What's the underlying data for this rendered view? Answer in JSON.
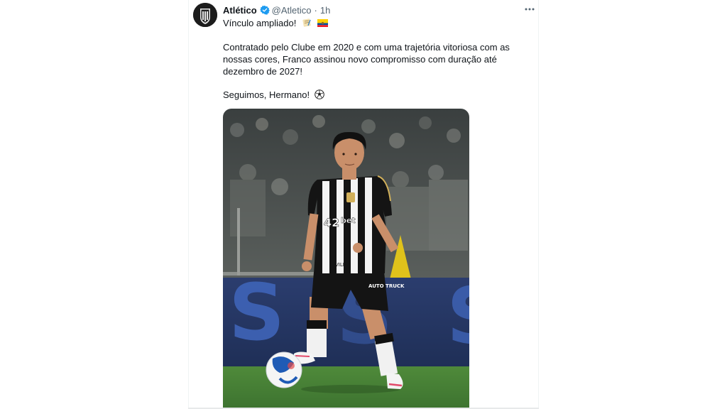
{
  "tweet": {
    "display_name": "Atlético",
    "handle": "@Atletico",
    "separator": "·",
    "time": "1h",
    "text_line1": "Vínculo ampliado!",
    "text_paragraph2": "Contratado pelo Clube em 2020 e com uma trajetória vitoriosa com as nossas cores, Franco assinou novo compromisso com duração até dezembro de 2027!",
    "text_line3": "Seguimos, Hermano!",
    "more_label": "···"
  },
  "media": {
    "image_text": {
      "sponsor": "bet",
      "sponsor_number": "42",
      "shorts_badge": "AUTO TRUCK",
      "sleeve_text": "VILMA",
      "board_letter": "S"
    }
  },
  "colors": {
    "accent": "#1d9bf0",
    "text": "#0f1419",
    "secondary": "#536471"
  },
  "icons": {
    "verified": "verified-badge-icon",
    "more": "more-options-icon",
    "scroll_emoji": "scroll-emoji-icon",
    "flag_emoji": "ecuador-flag-icon",
    "ball_emoji": "soccer-ball-icon"
  }
}
